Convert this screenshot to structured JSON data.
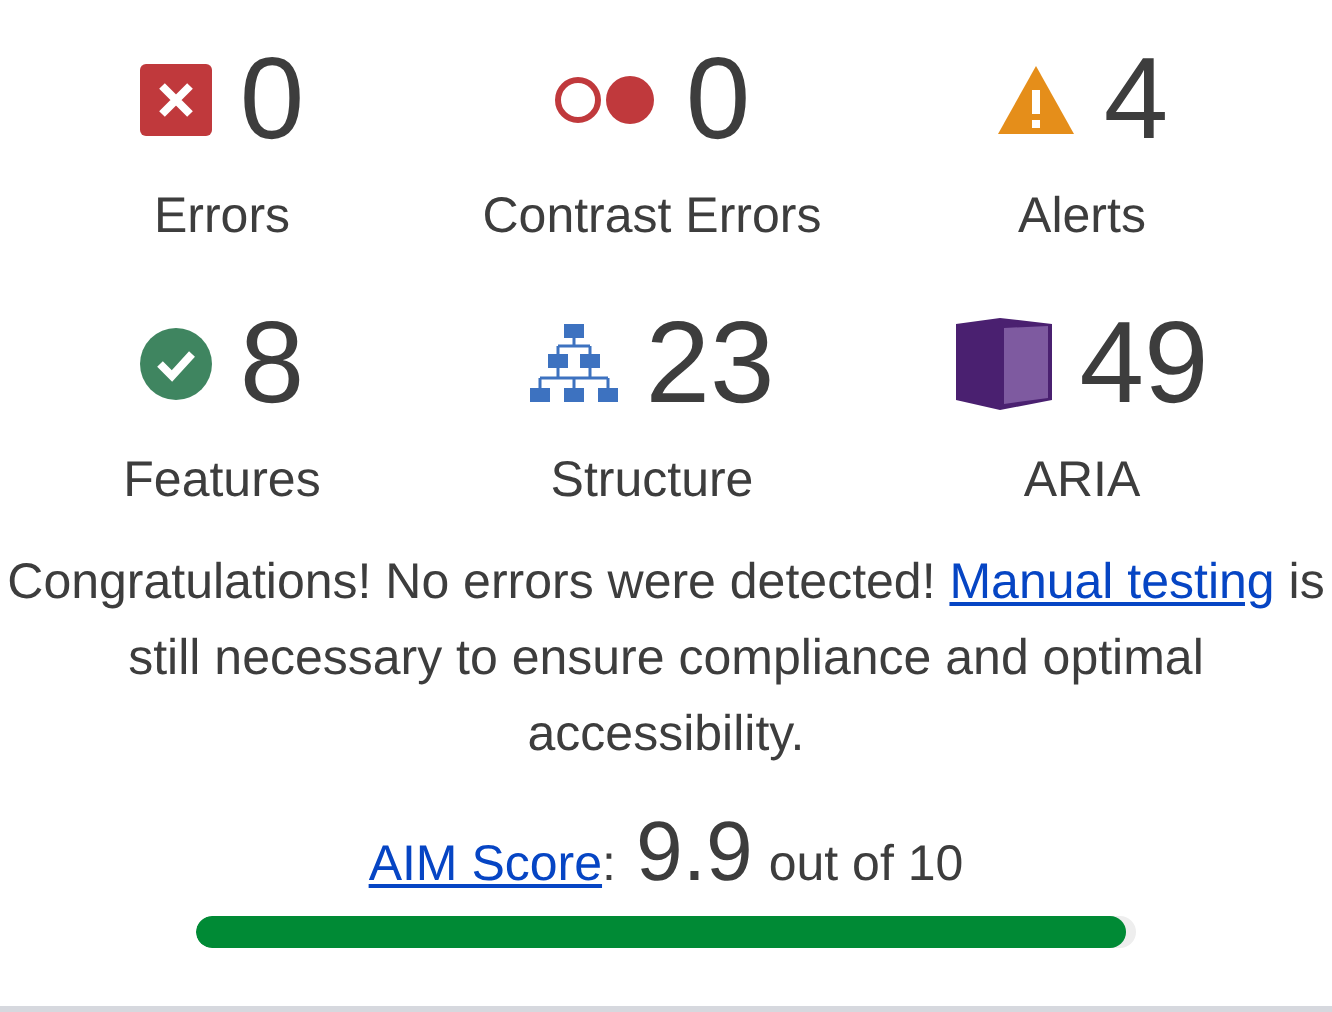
{
  "stats": [
    {
      "kind": "error",
      "count": "0",
      "label": "Errors"
    },
    {
      "kind": "contrast",
      "count": "0",
      "label": "Contrast Errors"
    },
    {
      "kind": "alert",
      "count": "4",
      "label": "Alerts"
    },
    {
      "kind": "feature",
      "count": "8",
      "label": "Features"
    },
    {
      "kind": "structure",
      "count": "23",
      "label": "Structure"
    },
    {
      "kind": "aria",
      "count": "49",
      "label": "ARIA"
    }
  ],
  "message": {
    "before": "Congratulations! No errors were detected!",
    "link": "Manual testing",
    "after": "is still necessary to ensure compliance and optimal accessibility."
  },
  "score": {
    "link": "AIM Score",
    "separator": ":",
    "value": "9.9",
    "suffix": "out of 10",
    "level": 0.99
  }
}
